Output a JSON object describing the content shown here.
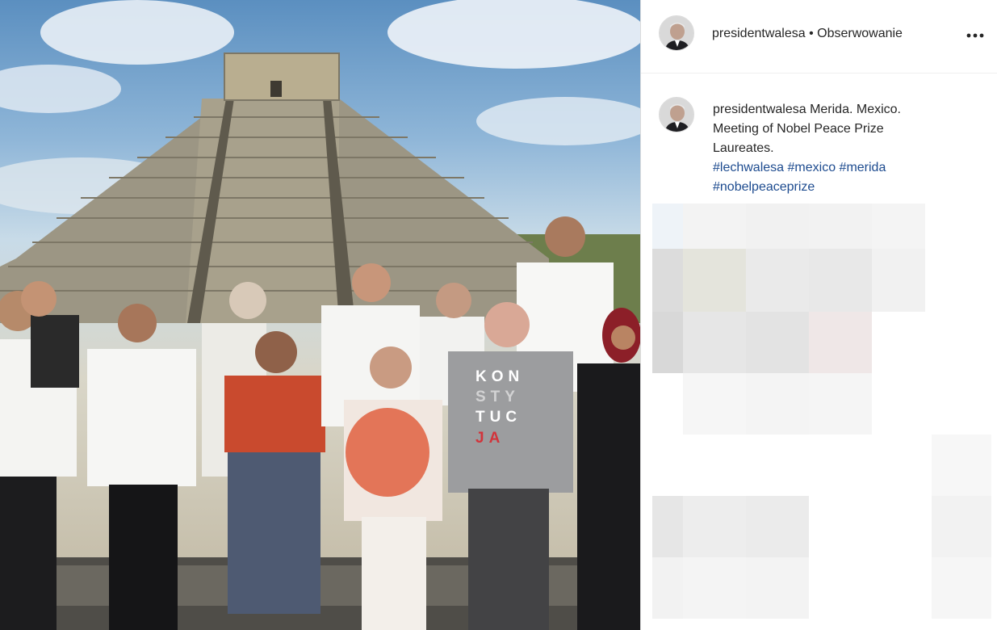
{
  "post": {
    "username": "presidentwalesa",
    "separator": " • ",
    "follow_label": "Obserwowanie",
    "more_icon": "more-horizontal-icon",
    "caption": {
      "username": "presidentwalesa",
      "text_line1": " Merida. Mexico.",
      "text_line2": "Meeting of Nobel Peace Prize",
      "text_line3": "Laureates.",
      "hashtags_line1": [
        "#lechwalesa",
        "#mexico",
        "#merida"
      ],
      "hashtags_line2": [
        "#nobelpeaceprize"
      ]
    },
    "photo": {
      "shirt_text": [
        "KON",
        "STY",
        "TUC",
        "JA"
      ]
    }
  },
  "colors": {
    "hashtag": "#1d4b8f",
    "text": "#262626",
    "divider": "#dbdbdb"
  }
}
